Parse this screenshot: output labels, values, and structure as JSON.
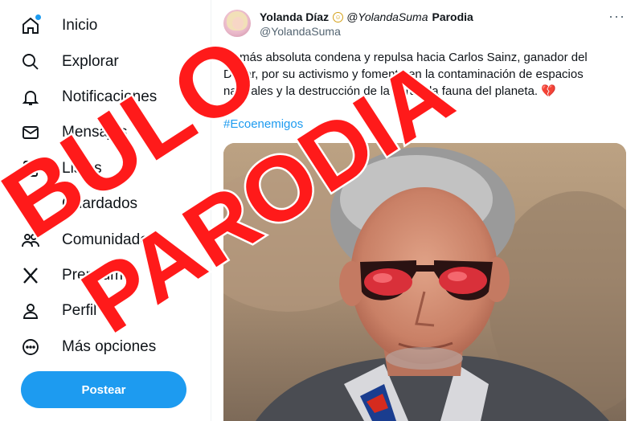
{
  "sidebar": {
    "items": [
      {
        "label": "Inicio",
        "icon": "home-icon"
      },
      {
        "label": "Explorar",
        "icon": "search-icon"
      },
      {
        "label": "Notificaciones",
        "icon": "bell-icon"
      },
      {
        "label": "Mensajes",
        "icon": "mail-icon"
      },
      {
        "label": "Listas",
        "icon": "list-icon"
      },
      {
        "label": "Guardados",
        "icon": "bookmark-icon"
      },
      {
        "label": "Comunidades",
        "icon": "communities-icon"
      },
      {
        "label": "Premium",
        "icon": "x-logo-icon"
      },
      {
        "label": "Perfil",
        "icon": "person-icon"
      },
      {
        "label": "Más opciones",
        "icon": "more-circle-icon"
      }
    ],
    "post_button": "Postear"
  },
  "tweet": {
    "display_name": "Yolanda Díaz",
    "handle_italic": "@YolandaSuma",
    "parody_word": "Parodia",
    "handle": "@YolandaSuma",
    "more_label": "···",
    "text": "Mi más absoluta condena y repulsa hacia Carlos Sainz, ganador del Dakar, por su activismo y fomento en la contaminación de espacios naturales y la destrucción de la flora y la fauna del planeta.",
    "emoji": "💔",
    "hashtag": "#Ecoenemigos"
  },
  "stamp": {
    "word1": "BULO",
    "word2": "PARODIA",
    "color": "#ff1a1a"
  },
  "colors": {
    "accent": "#1d9bf0",
    "text": "#0f1419",
    "muted": "#536471"
  }
}
